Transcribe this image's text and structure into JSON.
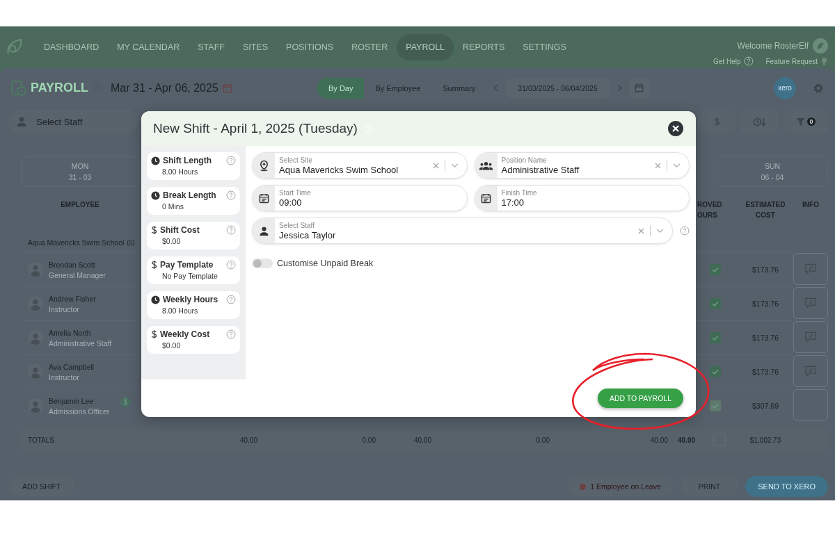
{
  "nav": {
    "items": [
      {
        "label": "DASHBOARD",
        "selected": false
      },
      {
        "label": "MY CALENDAR",
        "selected": false
      },
      {
        "label": "STAFF",
        "selected": false
      },
      {
        "label": "SITES",
        "selected": false
      },
      {
        "label": "POSITIONS",
        "selected": false
      },
      {
        "label": "ROSTER",
        "selected": false
      },
      {
        "label": "PAYROLL",
        "selected": true
      },
      {
        "label": "REPORTS",
        "selected": false
      },
      {
        "label": "SETTINGS",
        "selected": false
      }
    ],
    "welcome": "Welcome RosterElf",
    "help": "Get Help",
    "feature": "Feature Request"
  },
  "header": {
    "title": "PAYROLL",
    "date_range": "Mar 31 - Apr 06, 2025",
    "views": [
      {
        "label": "By Day",
        "selected": true
      },
      {
        "label": "By Employee",
        "selected": false
      },
      {
        "label": "Summary",
        "selected": false
      }
    ],
    "date_field": "31/03/2025 - 06/04/2025",
    "xero": "xero"
  },
  "toolbar": {
    "staff_placeholder": "Select Staff",
    "filter_count": "0"
  },
  "table": {
    "days": [
      {
        "day": "MON",
        "date": "31 - 03"
      },
      {
        "day": "SUN",
        "date": "06 - 04"
      }
    ],
    "columns": {
      "employee": "EMPLOYEE",
      "approved": "ROVED\nOURS",
      "cost": "ESTIMATED COST",
      "info": "INFO"
    },
    "group": {
      "name": "Aqua Mavericks Swim School",
      "count": "(5)"
    },
    "employees": [
      {
        "name": "Brendan Scott",
        "role": "General Manager",
        "pay_badge": false,
        "approved": true,
        "disabled": false,
        "cost": "$173.76",
        "note": true
      },
      {
        "name": "Andrew Fisher",
        "role": "Instructor",
        "pay_badge": false,
        "approved": true,
        "disabled": false,
        "cost": "$173.76",
        "note": true
      },
      {
        "name": "Amelia North",
        "role": "Administrative Staff",
        "pay_badge": false,
        "approved": true,
        "disabled": false,
        "cost": "$173.76",
        "note": true
      },
      {
        "name": "Ava Campbell",
        "role": "Instructor",
        "pay_badge": false,
        "approved": true,
        "disabled": false,
        "cost": "$173.76",
        "note": true
      },
      {
        "name": "Benjamin Lee",
        "role": "Admissions Officer",
        "pay_badge": true,
        "approved": true,
        "disabled": true,
        "cost": "$307.69",
        "note": false
      }
    ],
    "totals": {
      "label": "TOTALS",
      "values": [
        "40.00",
        "0.00",
        "40.00",
        "0.00",
        "40.00"
      ],
      "approved_hours": "40.00",
      "approved": false,
      "cost": "$1,002.73"
    }
  },
  "footer": {
    "add_shift": "ADD SHIFT",
    "leave": "1 Employee on Leave",
    "print": "PRINT",
    "send": "SEND TO XERO"
  },
  "modal": {
    "title": "New Shift - April 1, 2025 (Tuesday)",
    "stats": [
      {
        "kind": "clock",
        "label": "Shift Length",
        "value": "8.00 Hours"
      },
      {
        "kind": "clock",
        "label": "Break Length",
        "value": "0 Mins"
      },
      {
        "kind": "dollar",
        "label": "Shift Cost",
        "value": "$0.00"
      },
      {
        "kind": "dollar",
        "label": "Pay Template",
        "value": "No Pay Template"
      },
      {
        "kind": "clock",
        "label": "Weekly Hours",
        "value": "8.00 Hours"
      },
      {
        "kind": "dollar",
        "label": "Weekly Cost",
        "value": "$0.00"
      }
    ],
    "fields": [
      {
        "kind": "select",
        "label": "Select Site",
        "value": "Aqua Mavericks Swim School"
      },
      {
        "kind": "select",
        "label": "Position Name",
        "value": "Administrative Staff"
      },
      {
        "kind": "time",
        "label": "Start Time",
        "value": "09:00"
      },
      {
        "kind": "time",
        "label": "Finish Time",
        "value": "17:00"
      },
      {
        "kind": "select",
        "label": "Select Staff",
        "value": "Jessica Taylor"
      }
    ],
    "toggle": {
      "label": "Customise Unpaid Break",
      "on": false
    },
    "button": {
      "label": "ADD TO PAYROLL",
      "highlighted": true
    }
  }
}
